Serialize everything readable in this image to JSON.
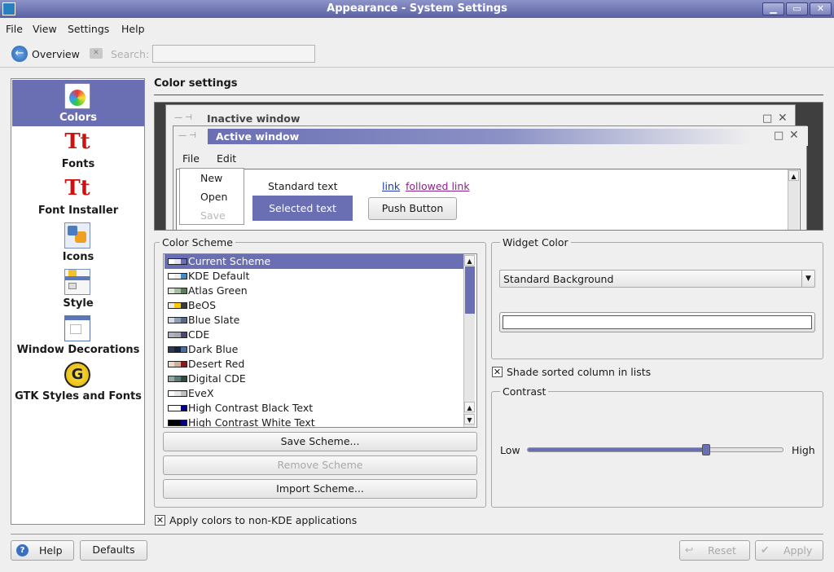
{
  "window": {
    "title": "Appearance - System Settings",
    "buttons": {
      "minimize": "▁",
      "maximize": "▭",
      "close": "✕"
    }
  },
  "menu": [
    "File",
    "View",
    "Settings",
    "Help"
  ],
  "toolbar": {
    "overview": "Overview",
    "search": "Search:",
    "search_value": ""
  },
  "sidebar": {
    "items": [
      {
        "label": "Colors",
        "icon": "colors-icon",
        "selected": true
      },
      {
        "label": "Fonts",
        "icon": "fonts-icon"
      },
      {
        "label": "Font Installer",
        "icon": "font-installer-icon"
      },
      {
        "label": "Icons",
        "icon": "icons-icon"
      },
      {
        "label": "Style",
        "icon": "style-icon"
      },
      {
        "label": "Window Decorations",
        "icon": "window-decorations-icon"
      },
      {
        "label": "GTK Styles and Fonts",
        "icon": "gtk-icon"
      }
    ]
  },
  "page": {
    "heading": "Color settings"
  },
  "preview": {
    "inactive_title": "Inactive window",
    "active_title": "Active window",
    "menu": [
      "File",
      "Edit"
    ],
    "popup": [
      "New",
      "Open",
      "Save"
    ],
    "standard_text": "Standard text",
    "selected_text": "Selected text",
    "link": "link",
    "followed_link": "followed link",
    "push_button": "Push Button"
  },
  "color_scheme": {
    "label": "Color Scheme",
    "items": [
      {
        "name": "Current Scheme",
        "selected": true,
        "swatch": [
          "#ffffff",
          "#e6e6f0",
          "#6a6fb3"
        ]
      },
      {
        "name": "KDE Default",
        "swatch": [
          "#ffffff",
          "#eeeeee",
          "#418ac4"
        ]
      },
      {
        "name": "Atlas Green",
        "swatch": [
          "#e5e5e0",
          "#a9bda4",
          "#5c7b5a"
        ]
      },
      {
        "name": "BeOS",
        "swatch": [
          "#ececec",
          "#ffcb00",
          "#3a3a3a"
        ]
      },
      {
        "name": "Blue Slate",
        "swatch": [
          "#d7dde8",
          "#8e9fb6",
          "#5b6b85"
        ]
      },
      {
        "name": "CDE",
        "swatch": [
          "#aeb2c3",
          "#a9a9a9",
          "#4a4a6a"
        ]
      },
      {
        "name": "Dark Blue",
        "swatch": [
          "#2d3a55",
          "#1a2438",
          "#4a6ea1"
        ]
      },
      {
        "name": "Desert Red",
        "swatch": [
          "#e7dccd",
          "#c8b49c",
          "#8b1a1a"
        ]
      },
      {
        "name": "Digital CDE",
        "swatch": [
          "#94a8a4",
          "#5c7c76",
          "#2f4a46"
        ]
      },
      {
        "name": "EveX",
        "swatch": [
          "#ffffff",
          "#e8e8e8",
          "#c0c0c0"
        ]
      },
      {
        "name": "High Contrast Black Text",
        "swatch": [
          "#ffffff",
          "#ffffff",
          "#000080"
        ]
      },
      {
        "name": "High Contrast White Text",
        "swatch": [
          "#000000",
          "#000000",
          "#000080"
        ]
      }
    ],
    "save": "Save Scheme...",
    "remove": "Remove Scheme",
    "import": "Import Scheme..."
  },
  "widget_color": {
    "label": "Widget Color",
    "selected": "Standard Background",
    "color_value": ""
  },
  "shade_sorted": {
    "label": "Shade sorted column in lists",
    "checked": true
  },
  "contrast": {
    "label": "Contrast",
    "low": "Low",
    "high": "High",
    "value": 0.7
  },
  "apply_nonkde": {
    "label": "Apply colors to non-KDE applications",
    "checked": true
  },
  "footer": {
    "help": "Help",
    "defaults": "Defaults",
    "reset": "Reset",
    "apply": "Apply"
  },
  "colors": {
    "accent": "#6a6fb3",
    "title_dark": "#5a61a3"
  }
}
